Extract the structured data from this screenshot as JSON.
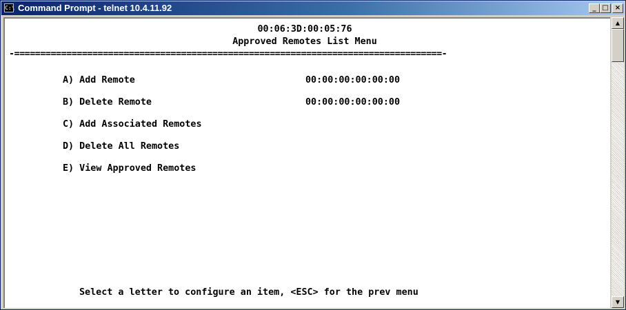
{
  "window": {
    "title": "Command Prompt - telnet 10.4.11.92",
    "app_icon": "cmd-icon",
    "buttons": {
      "minimize": "_",
      "maximize": "□",
      "close": "×"
    }
  },
  "console": {
    "mac_address": "00:06:3D:00:05:76",
    "menu_title": "Approved Remotes List Menu",
    "separator": "-==================================================================================-",
    "items": [
      {
        "label": "A) Add Remote",
        "value": "00:00:00:00:00:00"
      },
      {
        "label": "B) Delete Remote",
        "value": "00:00:00:00:00:00"
      },
      {
        "label": "C) Add Associated Remotes"
      },
      {
        "label": "D) Delete All Remotes"
      },
      {
        "label": "E) View Approved Remotes"
      }
    ],
    "prompt": "Select a letter to configure an item, <ESC> for the prev menu"
  },
  "scrollbar": {
    "up": "▲",
    "down": "▼"
  },
  "colors": {
    "titlebar_start": "#0a246a",
    "titlebar_end": "#a6caf0",
    "console_bg": "#ffffff",
    "console_text": "#000000"
  }
}
